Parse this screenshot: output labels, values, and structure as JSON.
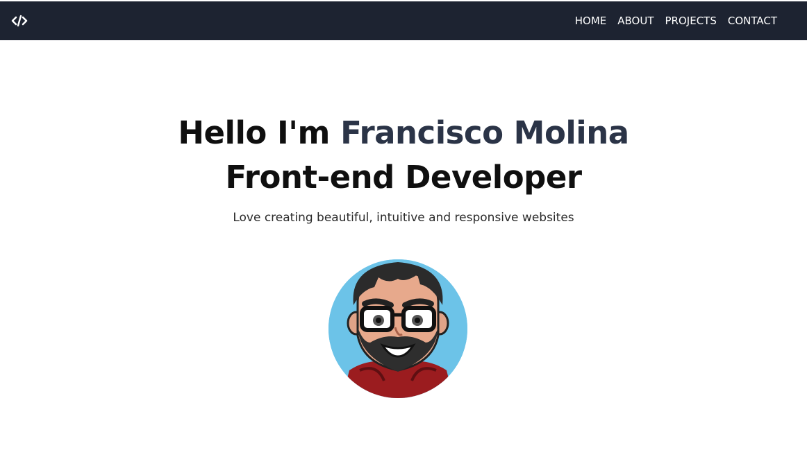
{
  "navbar": {
    "logo_icon": "code-slash-icon",
    "links": [
      {
        "label": "HOME"
      },
      {
        "label": "ABOUT"
      },
      {
        "label": "PROJECTS"
      },
      {
        "label": "CONTACT"
      }
    ],
    "background": "#1d2331"
  },
  "hero": {
    "greeting": "Hello I'm ",
    "name": "Francisco Molina",
    "role": "Front-end Developer",
    "tagline": "Love creating beautiful, intuitive and responsive websites",
    "avatar_icon": "cartoon-avatar-icon",
    "name_color": "#2b3447",
    "avatar_bg": "#6cc3e8"
  }
}
